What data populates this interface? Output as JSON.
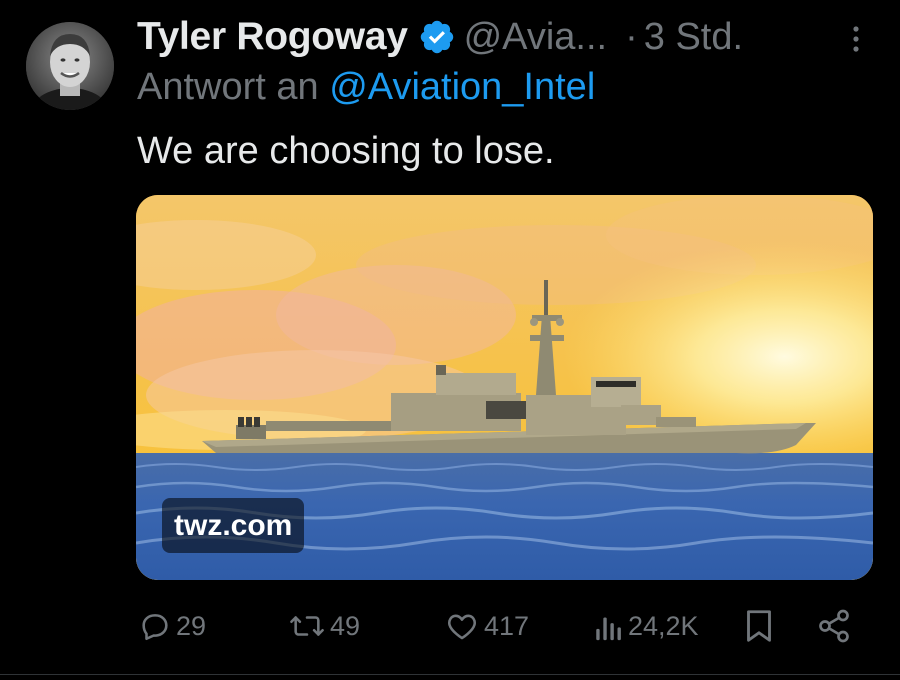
{
  "author": {
    "display_name": "Tyler Rogoway",
    "handle": "@Avia...",
    "dot": "·",
    "time": "3 Std.",
    "verified": true,
    "verified_color": "#1d9bf0"
  },
  "reply": {
    "prefix": "Antwort an",
    "mention": "@Aviation_Intel"
  },
  "tweet": {
    "text": "We are choosing to lose."
  },
  "media": {
    "source_label": "twz.com",
    "description": ""
  },
  "actions": {
    "replies": {
      "icon": "comment-icon",
      "count": "29"
    },
    "reposts": {
      "icon": "repost-icon",
      "count": "49"
    },
    "likes": {
      "icon": "heart-icon",
      "count": "417"
    },
    "views": {
      "icon": "views-icon",
      "count": "24,2K"
    },
    "bookmark": {
      "icon": "bookmark-icon"
    },
    "share": {
      "icon": "share-icon"
    }
  },
  "colors": {
    "background": "#000000",
    "primary_text": "#e7e9ea",
    "secondary_text": "#71767b",
    "accent": "#1d9bf0"
  }
}
